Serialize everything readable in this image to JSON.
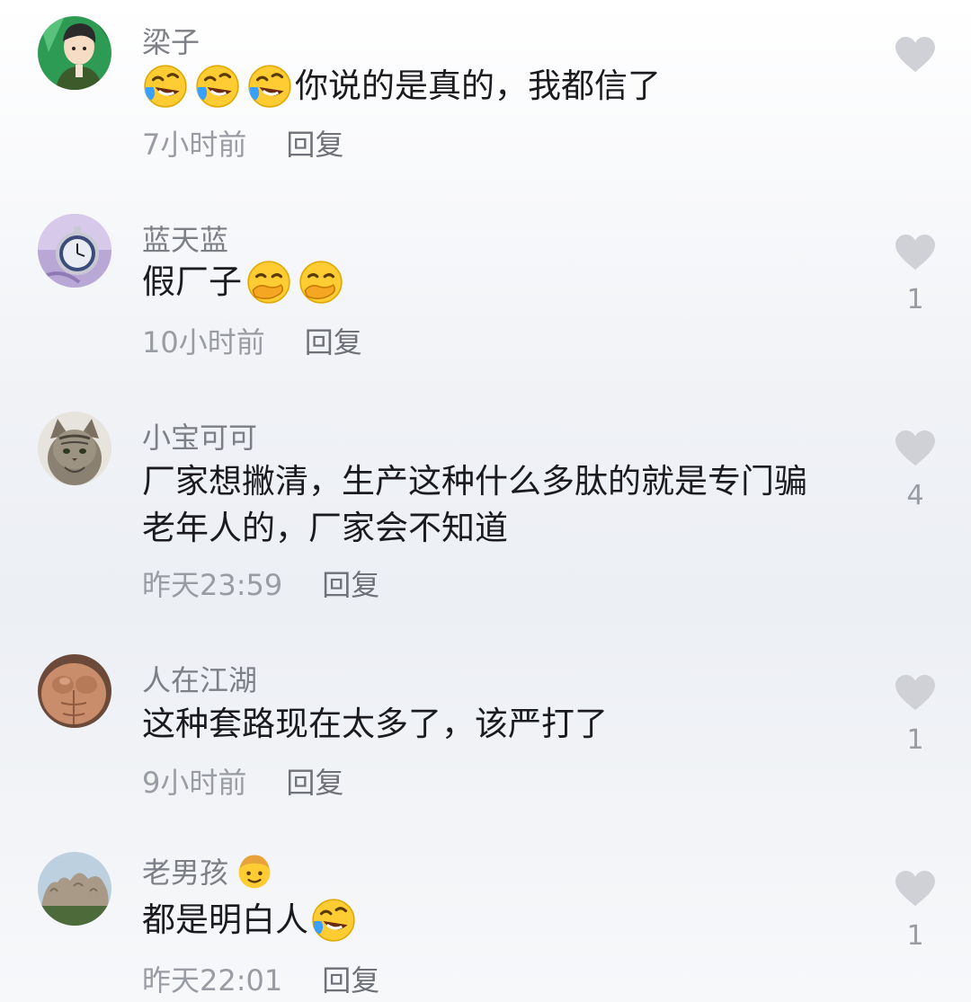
{
  "comments": [
    {
      "username": "梁子",
      "avatar": "avatar-anime-soldier",
      "emojis_before": [
        "rofl-emoji",
        "rofl-emoji",
        "rofl-emoji"
      ],
      "text": "你说的是真的，我都信了",
      "time": "7小时前",
      "reply_label": "回复",
      "likes": ""
    },
    {
      "username": "蓝天蓝",
      "avatar": "avatar-pocket-watch",
      "text": "假厂子",
      "emojis_after": [
        "smirk-hand-emoji",
        "smirk-hand-emoji"
      ],
      "time": "10小时前",
      "reply_label": "回复",
      "likes": "1"
    },
    {
      "username": "小宝可可",
      "avatar": "avatar-cat",
      "text_lines": [
        "厂家想撇清，生产这种什么多肽的就是专门骗",
        "老年人的，厂家会不知道"
      ],
      "time": "昨天23:59",
      "reply_label": "回复",
      "likes": "4"
    },
    {
      "username": "人在江湖",
      "avatar": "avatar-muscle",
      "text": "这种套路现在太多了，该严打了",
      "time": "9小时前",
      "reply_label": "回复",
      "likes": "1"
    },
    {
      "username": "老男孩",
      "username_badge": "boy-face-emoji",
      "avatar": "avatar-rock-sculpture",
      "text": "都是明白人",
      "emojis_after": [
        "rofl-emoji"
      ],
      "time": "昨天22:01",
      "reply_label": "回复",
      "likes": "1"
    }
  ],
  "colors": {
    "username": "#7d7f86",
    "body": "#1b1b1f",
    "meta": "#9a9ca3",
    "heart": "#cfd1d6"
  }
}
